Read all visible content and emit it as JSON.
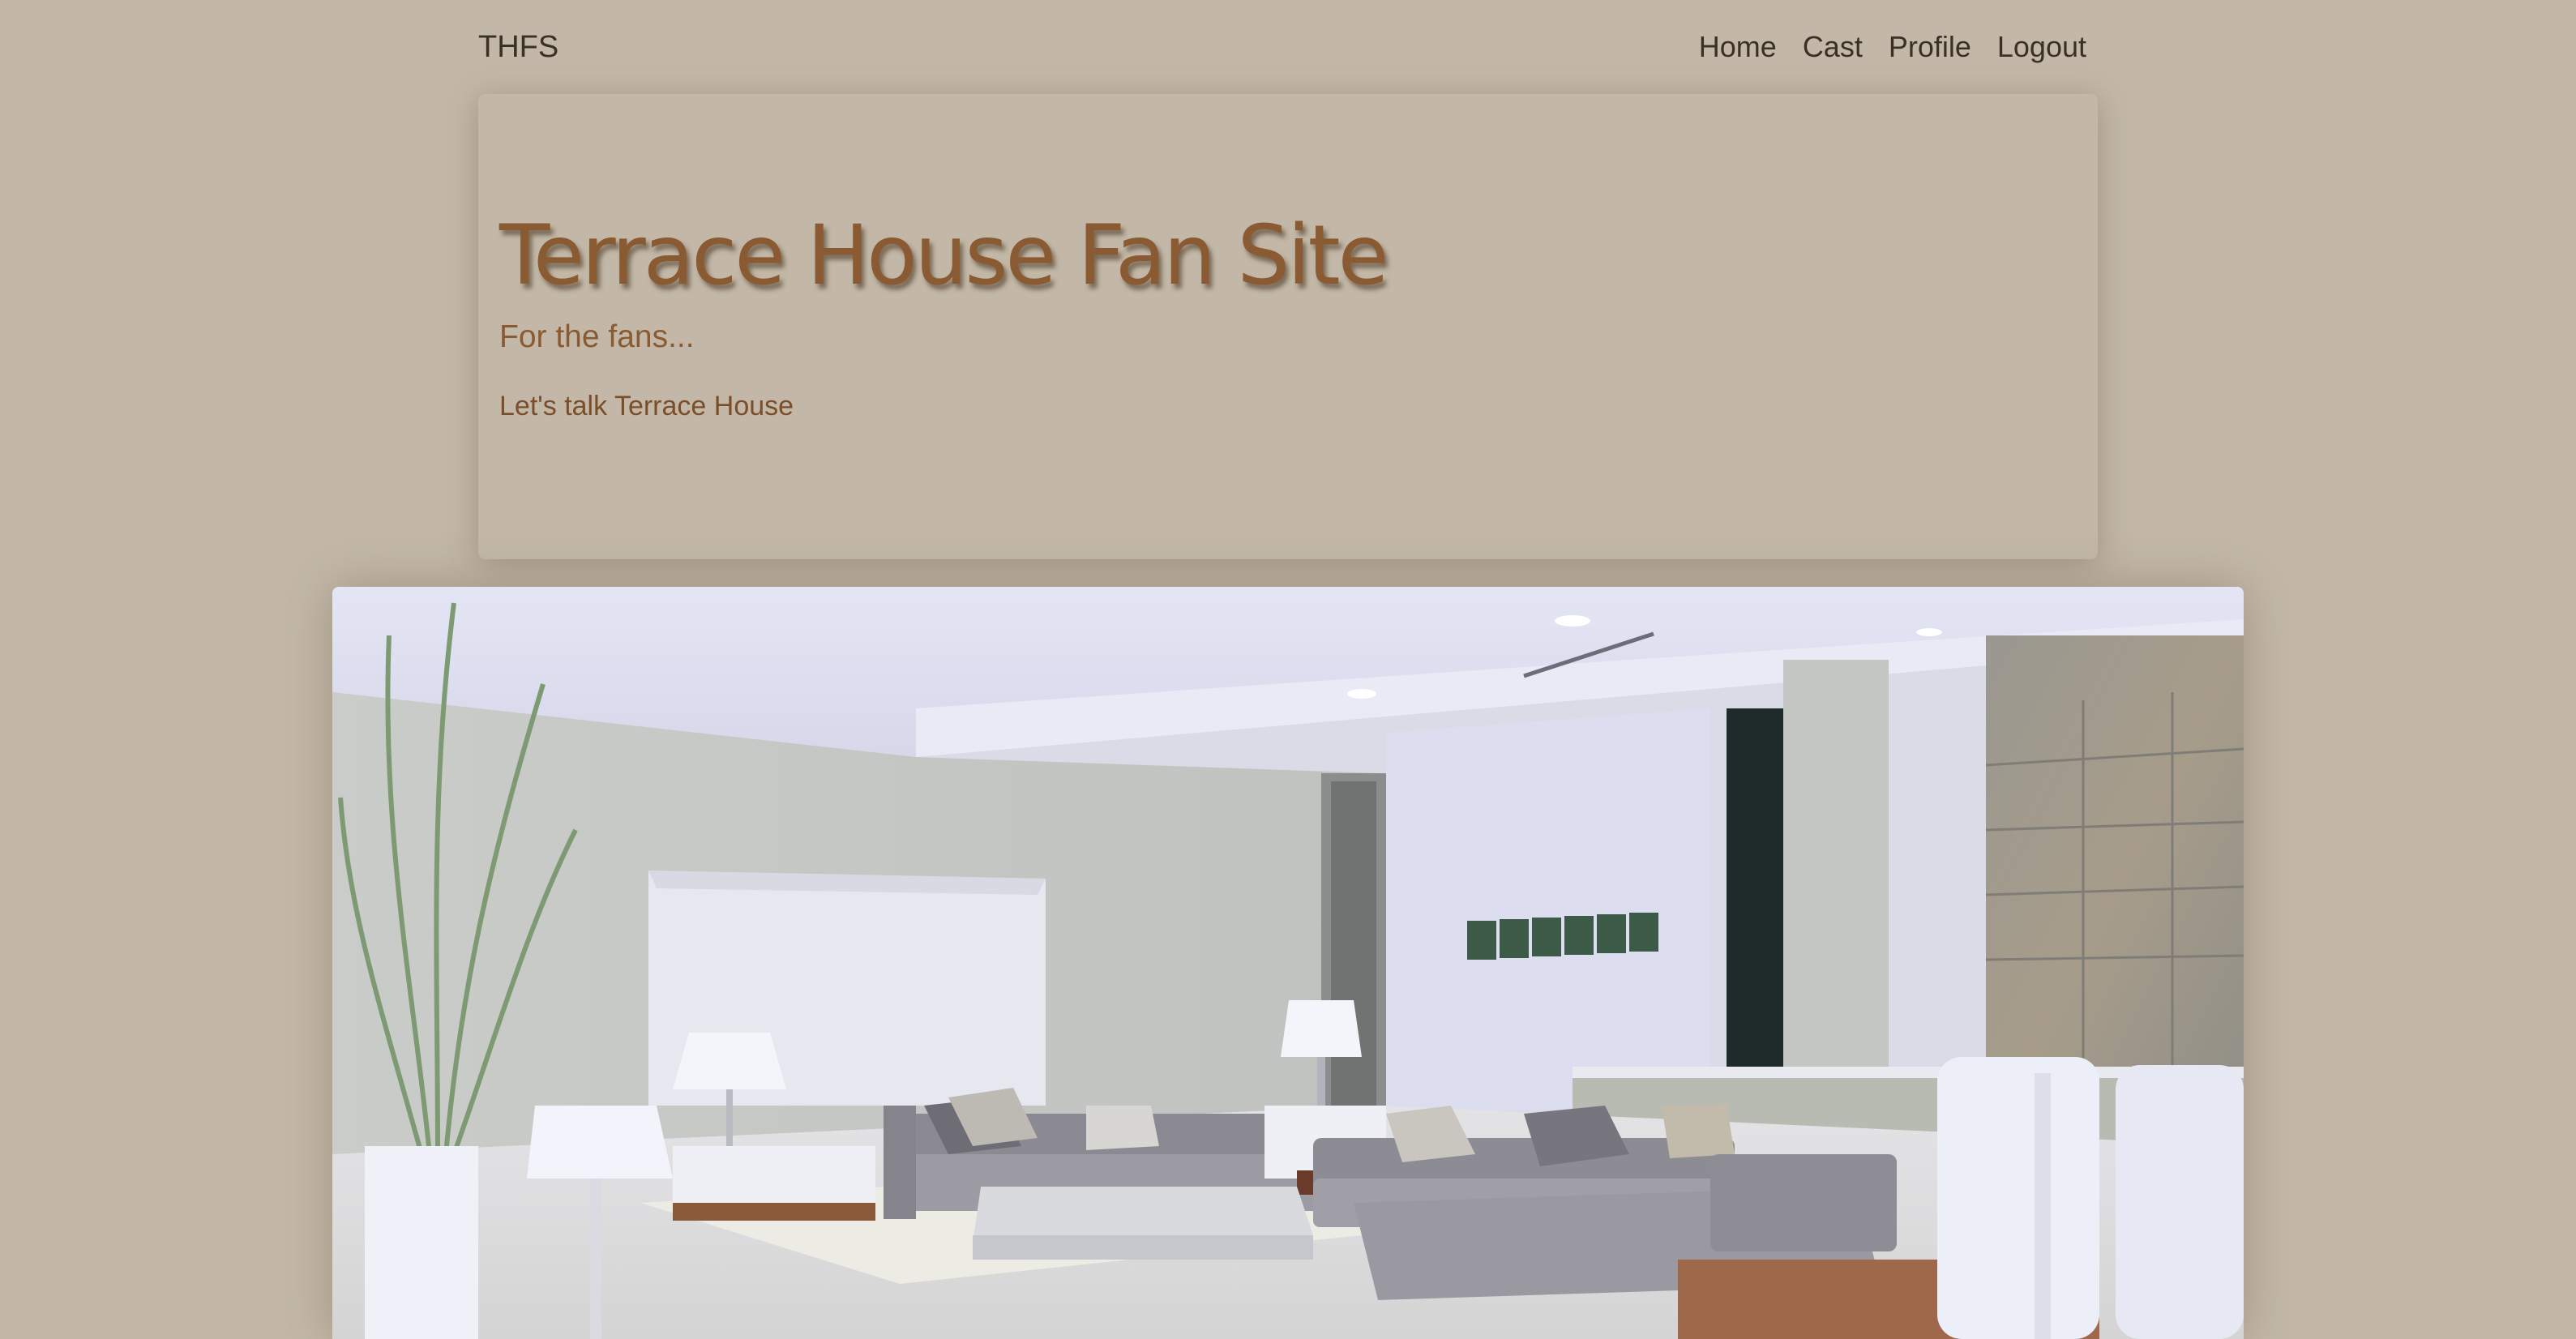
{
  "navbar": {
    "brand": "THFS",
    "links": [
      {
        "label": "Home"
      },
      {
        "label": "Cast"
      },
      {
        "label": "Profile"
      },
      {
        "label": "Logout"
      }
    ]
  },
  "jumbotron": {
    "title": "Terrace House Fan Site",
    "subtitle": "For the fans...",
    "text": "Let's talk Terrace House"
  },
  "colors": {
    "background": "#c3b8a7",
    "heading": "#8a5a32",
    "nav_text": "#3a3026"
  },
  "hero_image": {
    "description_icon": "living-room-photo"
  }
}
